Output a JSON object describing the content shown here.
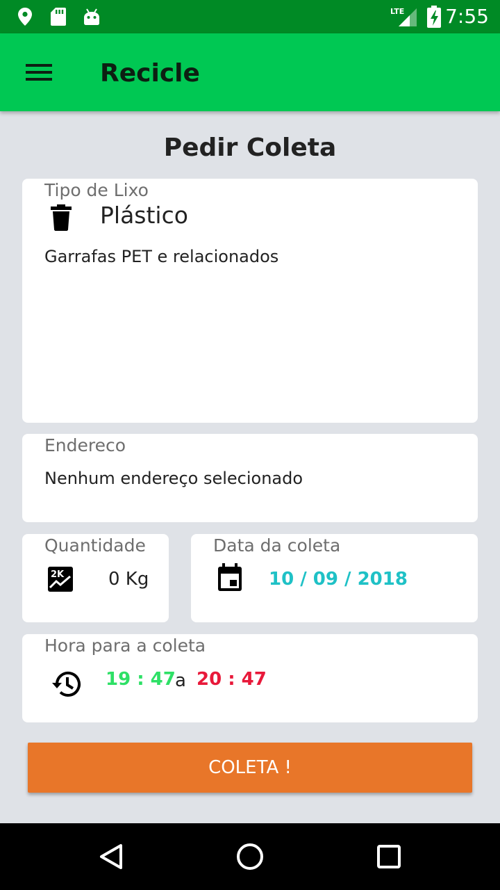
{
  "status_bar": {
    "time": "7:55",
    "network": "LTE",
    "icons": [
      "location-icon",
      "sd-card-icon",
      "android-icon",
      "lte-signal-icon",
      "battery-charging-icon"
    ]
  },
  "app_bar": {
    "title": "Recicle",
    "menu_icon": "hamburger-menu-icon"
  },
  "page": {
    "title": "Pedir Coleta"
  },
  "tipo_lixo": {
    "label": "Tipo de Lixo",
    "icon": "trash-icon",
    "value": "Plástico",
    "description": "Garrafas PET e relacionados"
  },
  "endereco": {
    "label": "Endereco",
    "value": "Nenhum endereço selecionado"
  },
  "quantidade": {
    "label": "Quantidade",
    "icon": "weight-chart-icon",
    "value": "0 Kg"
  },
  "data_coleta": {
    "label": "Data da coleta",
    "icon": "calendar-icon",
    "value": "10 / 09 / 2018"
  },
  "hora_coleta": {
    "label": "Hora para a coleta",
    "icon": "history-icon",
    "start": "19 : 47",
    "separator": "a",
    "end": "20 : 47"
  },
  "actions": {
    "submit_label": "COLETA !"
  },
  "colors": {
    "status_bar": "#008a25",
    "app_bar": "#00c853",
    "background": "#dfe2e7",
    "button": "#e87629",
    "date_text": "#1fc1c6",
    "start_time": "#2ee066",
    "end_time": "#e8193a"
  }
}
